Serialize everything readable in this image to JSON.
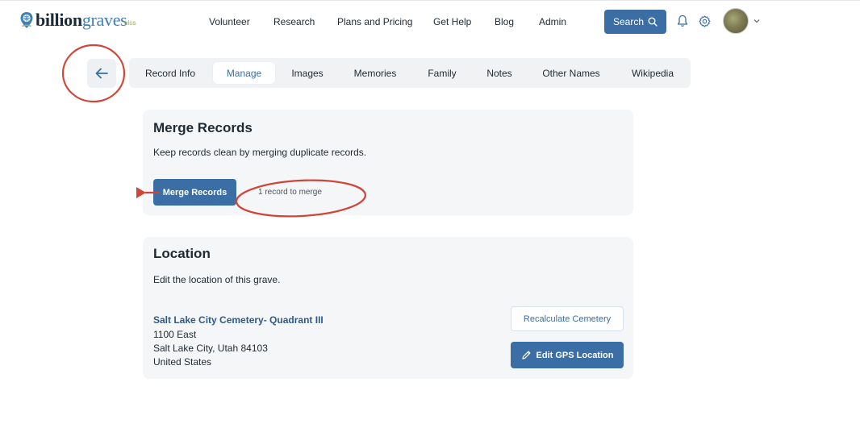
{
  "header": {
    "logo_main": "billion",
    "logo_accent": "graves",
    "logo_plus": "plus",
    "nav": [
      "Volunteer",
      "Research",
      "Plans and Pricing",
      "Get Help",
      "Blog",
      "Admin"
    ],
    "search_label": "Search",
    "icons": {
      "logo": "location-pin-globe-icon",
      "search": "search-icon",
      "notifications": "bell-icon",
      "settings": "gear-icon",
      "avatar_caret": "chevron-down-icon"
    }
  },
  "tabs": [
    "Record Info",
    "Manage",
    "Images",
    "Memories",
    "Family",
    "Notes",
    "Other Names",
    "Wikipedia"
  ],
  "active_tab": "Manage",
  "merge": {
    "title": "Merge Records",
    "description": "Keep records clean by merging duplicate records.",
    "button_label": "Merge Records",
    "count_text": "1 record to merge"
  },
  "location": {
    "title": "Location",
    "description": "Edit the location of this grave.",
    "cemetery_name": "Salt Lake City Cemetery- Quadrant III",
    "address_line1": "1100 East",
    "address_line2": "Salt Lake City, Utah 84103",
    "address_line3": "United States",
    "recalculate_label": "Recalculate Cemetery",
    "edit_gps_label": "Edit GPS Location"
  },
  "colors": {
    "primary": "#3a6ea5",
    "annotation": "#d0453a",
    "card_bg": "#f4f6f7",
    "logo_accent": "#3f7fb8"
  }
}
